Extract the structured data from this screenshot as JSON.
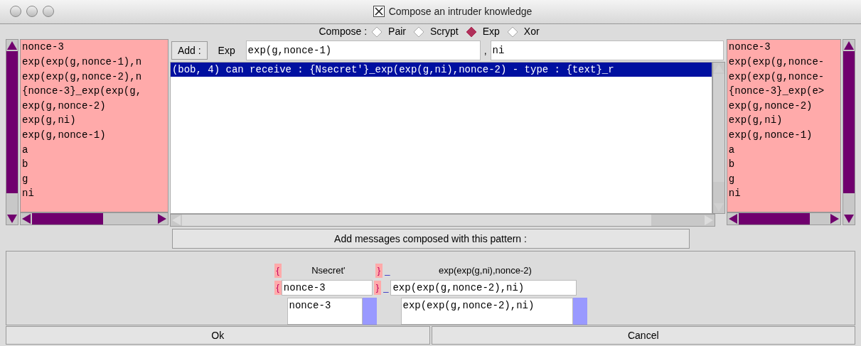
{
  "window": {
    "title": "Compose an intruder knowledge"
  },
  "compose": {
    "label": "Compose :",
    "options": [
      {
        "label": "Pair",
        "selected": false
      },
      {
        "label": "Scrypt",
        "selected": false
      },
      {
        "label": "Exp",
        "selected": true
      },
      {
        "label": "Xor",
        "selected": false
      }
    ]
  },
  "left_list": [
    "nonce-3",
    "exp(exp(g,nonce-1),n",
    "exp(exp(g,nonce-2),n",
    "{nonce-3}_exp(exp(g,",
    "exp(g,nonce-2)",
    "exp(g,ni)",
    "exp(g,nonce-1)",
    "a",
    "b",
    "g",
    "ni"
  ],
  "add_bar": {
    "button": "Add :",
    "operator": "Exp",
    "field_1": "exp(g,nonce-1)",
    "separator": ",",
    "field_2": "ni"
  },
  "messages": [
    {
      "text": "(bob, 4) can receive : {Nsecret'}_exp(exp(g,ni),nonce-2) - type : {text}_r",
      "selected": true
    }
  ],
  "right_list": [
    "nonce-3",
    "exp(exp(g,nonce-",
    "exp(exp(g,nonce-",
    "{nonce-3}_exp(e>",
    "exp(g,nonce-2)",
    "exp(g,ni)",
    "exp(g,nonce-1)",
    "a",
    "b",
    "g",
    "ni"
  ],
  "pattern_button": "Add messages composed with this pattern :",
  "pattern": {
    "open_brace": "{",
    "close_brace": "}",
    "subscript": "_",
    "heading_1": "Nsecret'",
    "heading_2": "exp(exp(g,ni),nonce-2)",
    "field_1": "nonce-3",
    "field_2": "exp(exp(g,nonce-2),ni)",
    "list_1": [
      "nonce-3"
    ],
    "list_2": [
      "exp(exp(g,nonce-2),ni)"
    ]
  },
  "buttons": [
    "Ok",
    "Cancel"
  ]
}
